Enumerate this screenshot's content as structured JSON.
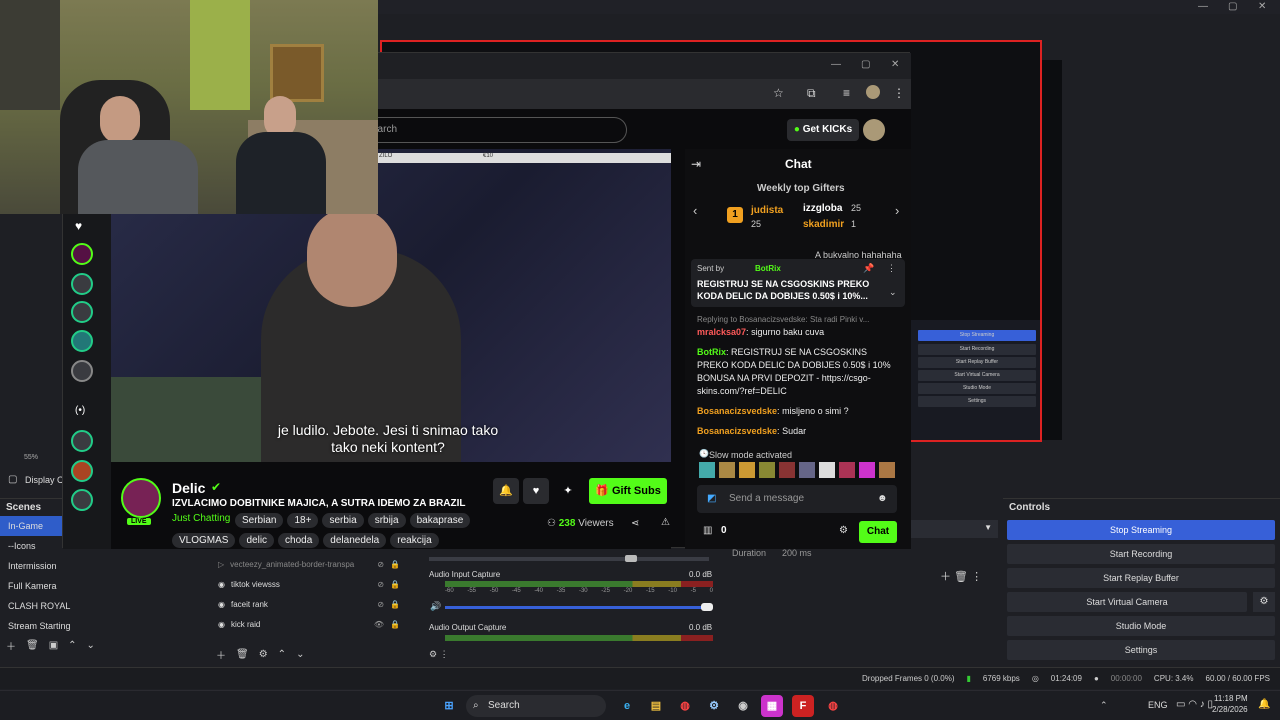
{
  "window": {
    "min": "—",
    "max": "▢",
    "close": "✕"
  },
  "preview": {
    "zoom": "55%",
    "display_capture": "Display C",
    "mini_buttons": [
      "Stop Streaming",
      "Start Recording",
      "Start Replay Buffer",
      "Start Virtual Camera",
      "Studio Mode",
      "Settings"
    ]
  },
  "scenes": {
    "title": "Scenes",
    "items": [
      "In-Game",
      "--Icons",
      "Intermission",
      "Full Kamera",
      "CLASH ROYAL",
      "Stream Starting"
    ]
  },
  "sources": {
    "items": [
      "vecteezy_animated-border-transpa",
      "tiktok viewsss",
      "faceit rank",
      "kick raid"
    ]
  },
  "mixer": {
    "input": {
      "label": "Audio Input Capture",
      "db": "0.0 dB"
    },
    "output": {
      "label": "Audio Output Capture",
      "db": "0.0 dB"
    },
    "ticks": [
      "-60",
      "-55",
      "-50",
      "-45",
      "-40",
      "-35",
      "-30",
      "-25",
      "-20",
      "-15",
      "-10",
      "-5",
      "0"
    ]
  },
  "transitions": {
    "duration_label": "Duration",
    "duration_value": "200 ms"
  },
  "controls": {
    "title": "Controls",
    "stop_streaming": "Stop Streaming",
    "start_recording": "Start Recording",
    "start_replay": "Start Replay Buffer",
    "start_virtual": "Start Virtual Camera",
    "studio_mode": "Studio Mode",
    "settings": "Settings"
  },
  "status": {
    "dropped": "Dropped Frames 0 (0.0%)",
    "kbps": "6769 kbps",
    "stream_time": "01:24:09",
    "rec_time": "00:00:00",
    "cpu": "CPU: 3.4%",
    "fps": "60.00 / 60.00 FPS"
  },
  "taskbar": {
    "search": "Search",
    "lang": "ENG",
    "time": "11:18 PM",
    "date": "2/28/2026"
  },
  "kick": {
    "search_placeholder": "earch",
    "get_kicks": "Get KICKs",
    "video_top_left": "ZILO",
    "video_top_right": "€10",
    "subtitle_line1": "je ludilo. Jebote. Jesi ti snimao tako",
    "subtitle_line2": "tako neki kontent?",
    "channel": "Delic",
    "stream_title": "IZVLACIMO DOBITNIKE MAJICA, A SUTRA IDEMO ZA BRAZIL",
    "category": "Just Chatting",
    "live": "LIVE",
    "tags_row1": [
      "Serbian",
      "18+",
      "serbia",
      "srbija",
      "bakaprase"
    ],
    "tags_row2": [
      "VLOGMAS",
      "delic",
      "choda",
      "delanedela",
      "reakcija"
    ],
    "viewers": "238",
    "viewers_label": "Viewers",
    "gift_subs": "Gift Subs"
  },
  "chat": {
    "title": "Chat",
    "weekly_gifters": "Weekly top Gifters",
    "gifters": [
      {
        "rank": "1",
        "name": "judista",
        "count": "25"
      },
      {
        "name": "izzgloba",
        "count": "25"
      },
      {
        "name": "skadimir",
        "count": "1"
      }
    ],
    "partial_msg": "A bukvalno hahahaha",
    "pinned_by_label": "Sent by",
    "pinned_by": "BotRix",
    "pinned_text": "REGISTRUJ SE NA CSGOSKINS PREKO KODA DELIC DA DOBIJES 0.50$ i 10%...",
    "reply_note": "Replying to Bosanacizsvedske: Sta radi Pinki v...",
    "messages": [
      {
        "user": "mralcksa07",
        "text": "sigurno baku cuva",
        "color": "#ff5a5a"
      },
      {
        "user": "BotRix",
        "text": "REGISTRUJ SE NA CSGOSKINS PREKO KODA DELIC DA DOBIJES 0.50$ i 10% BONUSA NA PRVI DEPOZIT - https://csgo-skins.com/?ref=DELIC",
        "color": "#53fc18"
      },
      {
        "user": "Bosanacizsvedske",
        "text": "misljeno o simi ?",
        "color": "#f0a020"
      },
      {
        "user": "Bosanacizsvedske",
        "text": "Sudar",
        "color": "#f0a020"
      }
    ],
    "slow_mode": "Slow mode activated",
    "input_placeholder": "Send a message",
    "points": "0",
    "send": "Chat"
  },
  "colors": {
    "kick_green": "#53fc18",
    "obs_blue": "#3760d8",
    "preview_border": "#dd2222"
  }
}
